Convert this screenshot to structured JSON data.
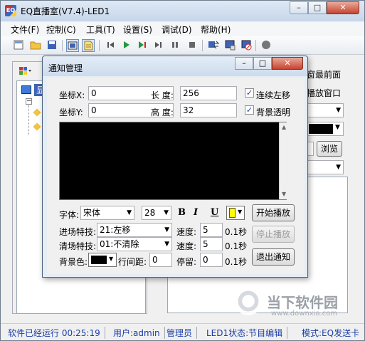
{
  "window": {
    "title": "EQ直播室(V7.4)-LED1",
    "app_icon_text": "EQ",
    "min_label": "–",
    "max_label": "□",
    "close_label": "✕"
  },
  "menu": [
    "文件(F)",
    "控制(C)",
    "工具(T)",
    "设置(S)",
    "调试(D)",
    "帮助(H)"
  ],
  "toolbar": {
    "icons": [
      "new-icon",
      "open-icon",
      "save-icon",
      "window-mode-icon",
      "notice-icon",
      "skip-back-icon",
      "play-icon",
      "play-step-icon",
      "skip-forward-icon",
      "pause-icon",
      "stop-icon",
      "send-icon",
      "screen-icon",
      "screen-off-icon",
      "record-icon"
    ]
  },
  "left_panel": {
    "tree_root_label": "显"
  },
  "right_panel": {
    "topmost_label": "窗最前面",
    "play_window_label": "播放窗口",
    "browse_button": "浏览"
  },
  "dialog": {
    "title": "通知管理",
    "x_label": "坐标X:",
    "x_value": "0",
    "y_label": "坐标Y:",
    "y_value": "0",
    "len_label": "长 度:",
    "len_value": "256",
    "height_label": "高 度:",
    "height_value": "32",
    "scroll_left_label": "连续左移",
    "scroll_left_checked": true,
    "transparent_label": "背景透明",
    "transparent_checked": true,
    "font_label": "字体:",
    "font_value": "宋体",
    "size_value": "28",
    "bold_label": "B",
    "italic_label": "I",
    "underline_label": "U",
    "text_color": "#ffff00",
    "enter_effect_label": "进场特技:",
    "enter_effect_value": "21:左移",
    "clear_effect_label": "清场特技:",
    "clear_effect_value": "01:不清除",
    "speed_label": "速度:",
    "enter_speed": "5",
    "clear_speed": "5",
    "unit": "0.1秒",
    "bg_color_label": "背景色:",
    "bg_color": "#000000",
    "line_spacing_label": "行间距:",
    "line_spacing_value": "0",
    "stay_label": "停留:",
    "stay_value": "0",
    "start_button": "开始播放",
    "stop_button": "停止播放",
    "exit_button": "退出通知"
  },
  "status": {
    "running": "软件已经运行 00:25:19",
    "user": "用户:admin",
    "role": "管理员",
    "led_state": "LED1状态:节目编辑",
    "mode": "模式:EQ发送卡"
  },
  "watermark": {
    "brand": "当下软件园",
    "url": "www.downxia.com"
  }
}
